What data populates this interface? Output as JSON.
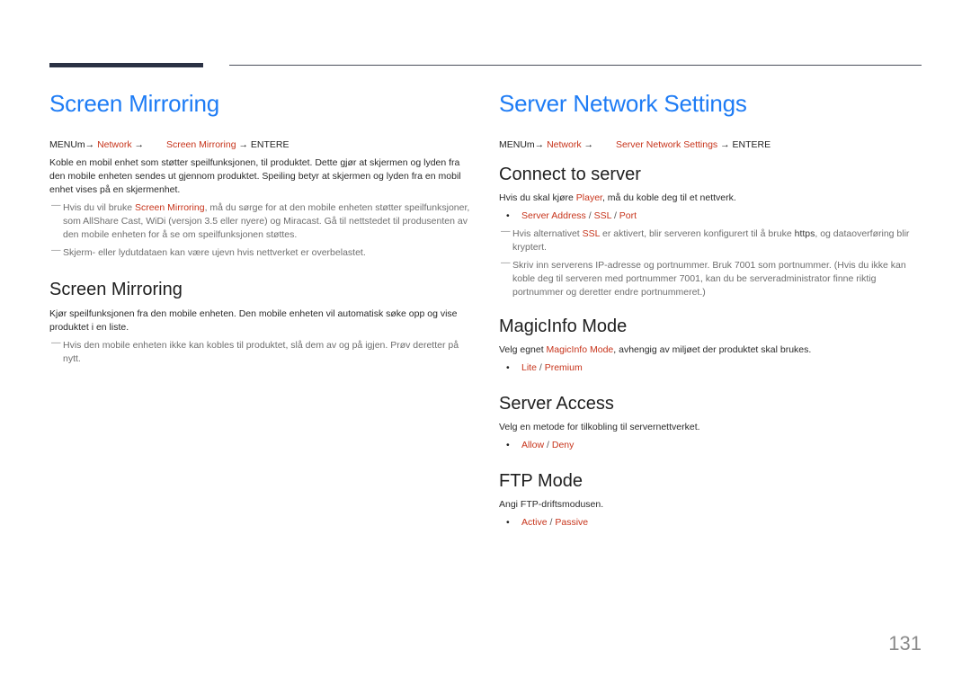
{
  "left": {
    "title": "Screen Mirroring",
    "menu_path": {
      "menu": "MENU",
      "menu_icon": "m",
      "step1": "Network",
      "arrow": "→",
      "step2": "Screen Mirroring",
      "enter": "ENTER",
      "enter_icon": "E"
    },
    "intro": "Koble en mobil enhet som støtter speilfunksjonen, til produktet. Dette gjør at skjermen og lyden fra den mobile enheten sendes ut gjennom produktet. Speiling betyr at skjermen og lyden fra en mobil enhet vises på en skjermenhet.",
    "notes": [
      {
        "before": "Hvis du vil bruke ",
        "highlight": "Screen Mirroring",
        "after": ", må du sørge for at den mobile enheten støtter speilfunksjoner, som AllShare Cast, WiDi (versjon 3.5 eller nyere) og Miracast. Gå til nettstedet til produsenten av den mobile enheten for å se om speilfunksjonen støttes."
      },
      {
        "text": "Skjerm- eller lydutdataen kan være ujevn hvis nettverket er overbelastet."
      }
    ],
    "section": {
      "heading": "Screen Mirroring",
      "text": "Kjør speilfunksjonen fra den mobile enheten. Den mobile enheten vil automatisk søke opp og vise produktet i en liste.",
      "note": "Hvis den mobile enheten ikke kan kobles til produktet, slå dem av og på igjen. Prøv deretter på nytt."
    }
  },
  "right": {
    "title": "Server Network Settings",
    "menu_path": {
      "menu": "MENU",
      "menu_icon": "m",
      "step1": "Network",
      "arrow": "→",
      "step2": "Server Network Settings",
      "enter": "ENTER",
      "enter_icon": "E"
    },
    "connect": {
      "heading": "Connect to server",
      "text_before": "Hvis du skal kjøre ",
      "text_highlight": "Player",
      "text_after": ", må du koble deg til et nettverk.",
      "options": [
        "Server Address",
        "SSL",
        "Port"
      ],
      "note1_before": "Hvis alternativet ",
      "note1_highlight": "SSL",
      "note1_middle": " er aktivert, blir serveren konfigurert til å bruke ",
      "note1_bold": "https",
      "note1_after": ", og dataoverføring blir kryptert.",
      "note2": "Skriv inn serverens IP-adresse og portnummer. Bruk 7001 som portnummer. (Hvis du ikke kan koble deg til serveren med portnummer 7001, kan du be serveradministrator finne riktig portnummer og deretter endre portnummeret.)"
    },
    "magicinfo": {
      "heading": "MagicInfo Mode",
      "text_before": "Velg egnet ",
      "text_highlight": "MagicInfo Mode",
      "text_after": ", avhengig av miljøet der produktet skal brukes.",
      "options": [
        "Lite",
        "Premium"
      ]
    },
    "access": {
      "heading": "Server Access",
      "text": "Velg en metode for tilkobling til servernettverket.",
      "options": [
        "Allow",
        "Deny"
      ]
    },
    "ftp": {
      "heading": "FTP Mode",
      "text": "Angi FTP-driftsmodusen.",
      "options": [
        "Active",
        "Passive"
      ]
    }
  },
  "separators": {
    "slash": " / ",
    "bullet": "•",
    "note_dash": "—"
  },
  "page_number": "131",
  "colors": {
    "title_blue": "#1e7cf5",
    "highlight_red": "#c7341b",
    "bar_dark": "#2b3244"
  }
}
